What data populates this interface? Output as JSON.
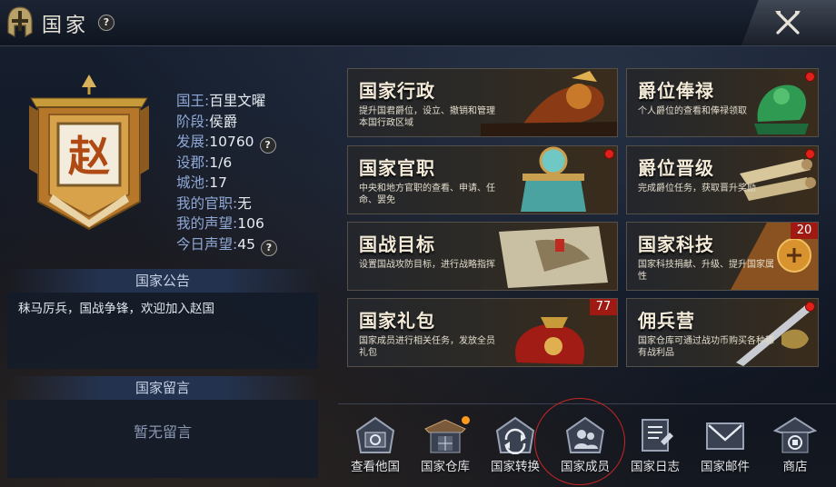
{
  "header": {
    "title": "国家"
  },
  "banner": {
    "character": "赵"
  },
  "info": [
    {
      "label": "国王:",
      "value": "百里文曜",
      "help": false
    },
    {
      "label": "阶段:",
      "value": "侯爵",
      "help": false
    },
    {
      "label": "发展:",
      "value": "10760",
      "help": true
    },
    {
      "label": "设郡:",
      "value": "1/6",
      "help": false
    },
    {
      "label": "城池:",
      "value": "17",
      "help": false
    },
    {
      "label": "我的官职:",
      "value": "无",
      "help": false
    },
    {
      "label": "我的声望:",
      "value": "106",
      "help": false
    },
    {
      "label": "今日声望:",
      "value": "45",
      "help": true
    }
  ],
  "notice": {
    "title": "国家公告",
    "text": "秣马厉兵，国战争锋，欢迎加入赵国"
  },
  "messages": {
    "title": "国家留言",
    "empty": "暂无留言"
  },
  "cards": [
    {
      "title": "国家行政",
      "desc": "提升国君爵位，设立、撤销和管理本国行政区域",
      "dot": false,
      "badge": ""
    },
    {
      "title": "爵位俸禄",
      "desc": "个人爵位的查看和俸禄领取",
      "dot": true,
      "badge": ""
    },
    {
      "title": "国家官职",
      "desc": "中央和地方官职的查看、申请、任命、罢免",
      "dot": true,
      "badge": ""
    },
    {
      "title": "爵位晋级",
      "desc": "完成爵位任务，获取晋升奖励",
      "dot": true,
      "badge": ""
    },
    {
      "title": "国战目标",
      "desc": "设置国战攻防目标，进行战略指挥",
      "dot": false,
      "badge": ""
    },
    {
      "title": "国家科技",
      "desc": "国家科技捐献、升级、提升国家属性",
      "dot": false,
      "badge": "20"
    },
    {
      "title": "国家礼包",
      "desc": "国家成员进行相关任务，发放全员礼包",
      "dot": false,
      "badge": "77"
    },
    {
      "title": "佣兵营",
      "desc": "国家仓库可通过战功币购买各种稀有战利品",
      "dot": true,
      "badge": ""
    }
  ],
  "bottom": [
    {
      "label": "查看他国",
      "icon": "other-countries-icon"
    },
    {
      "label": "国家仓库",
      "icon": "warehouse-icon"
    },
    {
      "label": "国家转换",
      "icon": "transfer-icon"
    },
    {
      "label": "国家成员",
      "icon": "members-icon"
    },
    {
      "label": "国家日志",
      "icon": "log-icon"
    },
    {
      "label": "国家邮件",
      "icon": "mail-icon"
    },
    {
      "label": "商店",
      "icon": "shop-icon"
    }
  ],
  "colors": {
    "accent_gold": "#c79a3a",
    "label_blue": "#8fa8d6",
    "alert_red": "#e0201a",
    "alert_orange": "#ff9a20"
  }
}
